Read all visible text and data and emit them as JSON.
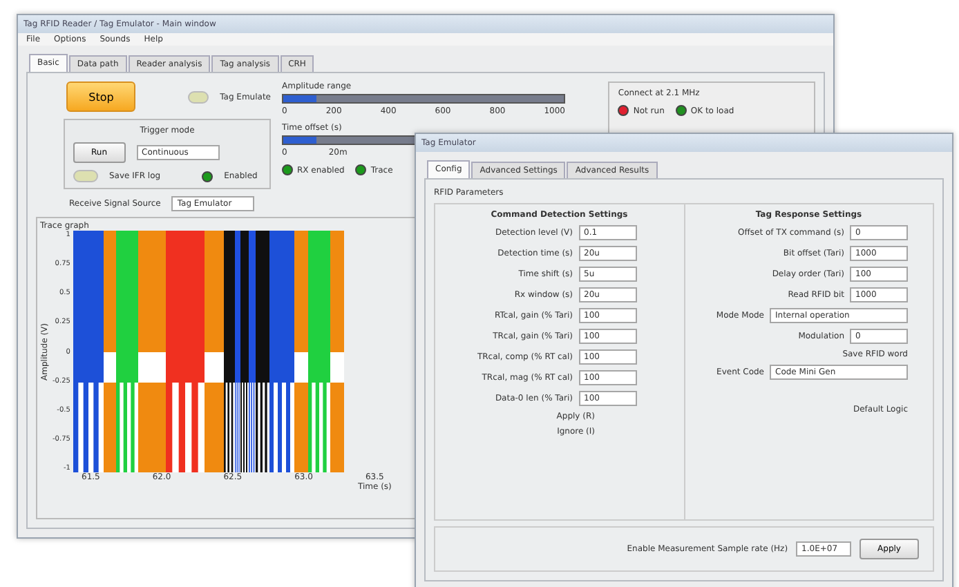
{
  "main_window": {
    "title": "Tag RFID Reader / Tag Emulator - Main window",
    "menu": [
      "File",
      "Options",
      "Sounds",
      "Help"
    ],
    "tabs": [
      {
        "label": "Basic",
        "selected": true
      },
      {
        "label": "Data path",
        "selected": false
      },
      {
        "label": "Reader analysis",
        "selected": false
      },
      {
        "label": "Tag analysis",
        "selected": false
      },
      {
        "label": "CRH",
        "selected": false
      }
    ],
    "stop_button": "Stop",
    "emulate_switch": {
      "label": "Tag Emulate",
      "on": false
    },
    "trigger": {
      "title": "Trigger mode",
      "run_button": "Run",
      "mode": "Continuous",
      "save_switch": {
        "label": "Save IFR log",
        "on": false
      },
      "led": {
        "label": "Enabled",
        "on": true
      }
    },
    "source": {
      "label": "Receive Signal Source",
      "value": "Tag Emulator"
    },
    "sliders": [
      {
        "label": "Amplitude range",
        "level": 0.12,
        "ticks": [
          "0",
          "200",
          "400",
          "600",
          "800",
          "1000"
        ]
      },
      {
        "label": "Time offset (s)",
        "level": 0.12,
        "ticks": [
          "0",
          "20m"
        ]
      }
    ],
    "leds": [
      {
        "label": "RX enabled",
        "on": true
      },
      {
        "label": "Trace",
        "on": true
      }
    ],
    "status": {
      "title": "Connect at 2.1 MHz",
      "leds": [
        {
          "label": "Not run",
          "color": "#e02030"
        },
        {
          "label": "OK to load",
          "color": "#209020"
        }
      ]
    },
    "chart": {
      "title": "Trace graph",
      "ylabel": "Amplitude (V)",
      "xlabel": "Time (s)",
      "yticks": [
        "1",
        "0.75",
        "0.5",
        "0.25",
        "0",
        "-0.25",
        "-0.5",
        "-0.75",
        "-1"
      ],
      "xticks": [
        "61.5",
        "62.0",
        "62.5",
        "63.0",
        "63.5"
      ]
    }
  },
  "dialog": {
    "title": "Tag Emulator",
    "tabs": [
      {
        "label": "Config",
        "selected": true
      },
      {
        "label": "Advanced Settings",
        "selected": false
      },
      {
        "label": "Advanced Results",
        "selected": false
      }
    ],
    "group_title": "RFID Parameters",
    "left": {
      "title": "Command Detection Settings",
      "fields": [
        {
          "label": "Detection level (V)",
          "value": "0.1"
        },
        {
          "label": "Detection time (s)",
          "value": "20u"
        },
        {
          "label": "Time shift (s)",
          "value": "5u"
        },
        {
          "label": "Rx window (s)",
          "value": "20u"
        },
        {
          "label": "RTcal, gain (% Tari)",
          "value": "100"
        },
        {
          "label": "TRcal, gain (% Tari)",
          "value": "100"
        },
        {
          "label": "TRcal, comp (% RT cal)",
          "value": "100"
        },
        {
          "label": "TRcal, mag (% RT cal)",
          "value": "100"
        },
        {
          "label": "Data-0 len (% Tari)",
          "value": "100"
        }
      ],
      "notes": [
        "Apply (R)",
        "Ignore (I)"
      ]
    },
    "right": {
      "title": "Tag Response Settings",
      "fields": [
        {
          "label": "Offset of TX command (s)",
          "value": "0"
        },
        {
          "label": "Bit offset (Tari)",
          "value": "1000"
        },
        {
          "label": "Delay order (Tari)",
          "value": "100"
        },
        {
          "label": "Read RFID bit",
          "value": "1000"
        }
      ],
      "mode": {
        "label": "Mode Mode",
        "value": "Internal operation"
      },
      "modulation": {
        "label": "Modulation",
        "value": "0"
      },
      "save_label": "Save RFID word",
      "event": {
        "label": "Event Code",
        "value": "Code Mini Gen"
      },
      "default_label": "Default Logic"
    },
    "footer": {
      "label": "Enable Measurement Sample rate (Hz)",
      "value": "1.0E+07",
      "apply": "Apply"
    }
  }
}
